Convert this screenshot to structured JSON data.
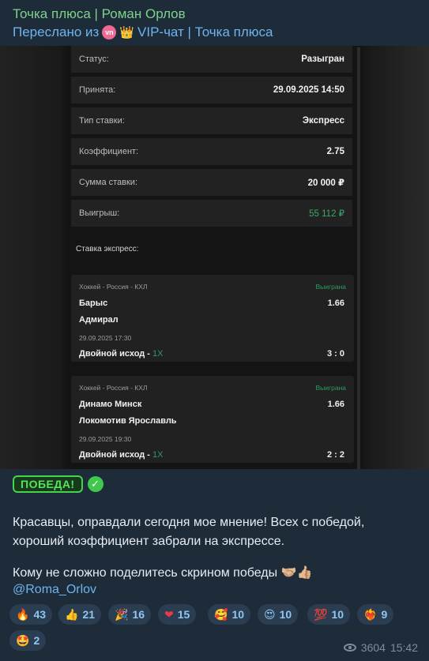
{
  "header": {
    "sender": "Точка плюса | Роман Орлов",
    "forwarded_prefix": "Переслано из",
    "forwarded_badge": "vn",
    "forwarded_crown": "👑",
    "forwarded_source": "VIP-чат | Точка плюса"
  },
  "bet": {
    "rows": [
      {
        "label": "Статус:",
        "value": "Разыгран"
      },
      {
        "label": "Принята:",
        "value": "29.09.2025 14:50"
      },
      {
        "label": "Тип ставки:",
        "value": "Экспресс"
      },
      {
        "label": "Коэффициент:",
        "value": "2.75"
      },
      {
        "label": "Сумма ставки:",
        "value": "20 000 ₽"
      },
      {
        "label": "Выигрыш:",
        "value": "55 112 ₽"
      }
    ],
    "section_title": "Ставка экспресс:",
    "cards": [
      {
        "league": "Хоккей - Россия - КХЛ",
        "status": "Выиграна",
        "team1": "Барыс",
        "team2": "Адмирал",
        "odd": "1.66",
        "datetime": "29.09.2025 17:30",
        "market": "Двойной исход - ",
        "pick": "1X",
        "score": "3 : 0"
      },
      {
        "league": "Хоккей - Россия - КХЛ",
        "status": "Выиграна",
        "team1": "Динамо Минск",
        "team2": "Локомотив Ярославль",
        "odd": "1.66",
        "datetime": "29.09.2025 19:30",
        "market": "Двойной исход - ",
        "pick": "1X",
        "score": "2 : 2"
      }
    ]
  },
  "message": {
    "victory_label": "ПОБЕДА!",
    "check": "✓",
    "text1": "Красавцы, оправдали сегодня мое мнение! Всех с победой, хороший коэффициент забрали на экспрессе.",
    "text2": "Кому не сложно поделитесь скрином победы 🤝🏼👍🏼",
    "mention": "@Roma_Orlov"
  },
  "reactions": [
    {
      "emoji": "🔥",
      "count": "43"
    },
    {
      "emoji": "👍",
      "count": "21"
    },
    {
      "emoji": "🎉",
      "count": "16"
    },
    {
      "emoji": "❤",
      "count": "15"
    },
    {
      "emoji": "🥰",
      "count": "10"
    },
    {
      "emoji": "😍",
      "count": "10"
    },
    {
      "emoji": "💯",
      "count": "10"
    },
    {
      "emoji": "❤‍🔥",
      "count": "9"
    },
    {
      "emoji": "🤩",
      "count": "2"
    }
  ],
  "meta": {
    "views": "3604",
    "time": "15:42"
  },
  "colors": {
    "bubble": "#1e2c3a",
    "sender": "#7ed28a",
    "link": "#6eb4ee",
    "win_green": "#2e9b62",
    "reaction_bg": "#2b3d50"
  }
}
